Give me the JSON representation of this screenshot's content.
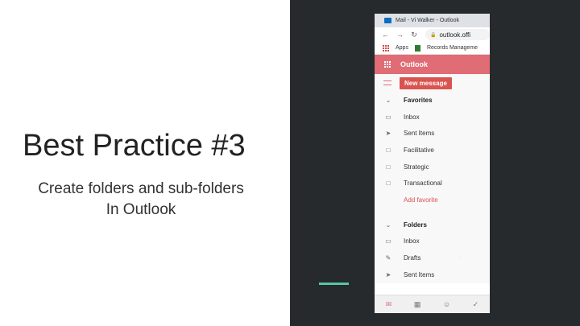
{
  "slide": {
    "title": "Best Practice #3",
    "subtitle_line1": "Create folders and sub-folders",
    "subtitle_line2": "In Outlook"
  },
  "colors": {
    "dark_panel": "#262a2c",
    "accent": "#58c6a2",
    "outlook_header": "#e06c75",
    "new_message_button": "#d9534f"
  },
  "browser": {
    "tab_title": "Mail - Vi Walker - Outlook",
    "url": "outlook.offi",
    "bookmarks": {
      "apps": "Apps",
      "records": "Records Manageme"
    }
  },
  "outlook": {
    "app_name": "Outlook",
    "new_message": "New message",
    "favorites": {
      "header": "Favorites",
      "items": [
        {
          "label": "Inbox",
          "icon": "inbox-icon"
        },
        {
          "label": "Sent Items",
          "icon": "send-icon"
        },
        {
          "label": "Facilitative",
          "icon": "folder-icon"
        },
        {
          "label": "Strategic",
          "icon": "folder-icon"
        },
        {
          "label": "Transactional",
          "icon": "folder-icon"
        }
      ],
      "add_favorite": "Add favorite"
    },
    "folders": {
      "header": "Folders",
      "items": [
        {
          "label": "Inbox",
          "icon": "inbox-icon"
        },
        {
          "label": "Drafts",
          "icon": "pencil-icon"
        },
        {
          "label": "Sent Items",
          "icon": "send-icon"
        }
      ]
    },
    "bottom_icons": [
      "mail-icon",
      "calendar-icon",
      "people-icon",
      "tasks-icon"
    ]
  }
}
